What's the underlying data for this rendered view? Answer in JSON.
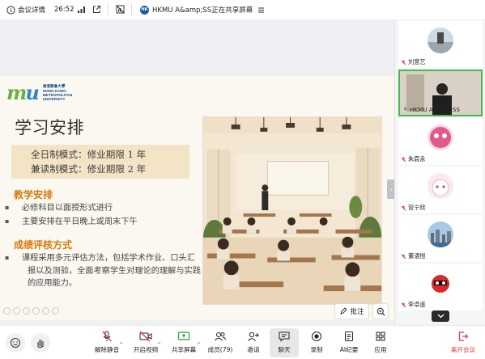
{
  "topbar": {
    "meeting_details": "会议详情",
    "timer": "26:52",
    "sharing_text": "HKMU A&amp;SS正在共享屏幕",
    "share_badge": "HK"
  },
  "slide": {
    "logo_mark_a": "m",
    "logo_mark_b": "u",
    "logo_lines": [
      "香港都會大學",
      "HONG KONG",
      "METROPOLITAN",
      "UNIVERSITY"
    ],
    "title": "学习安排",
    "modes": [
      "全日制模式：修业期限 1 年",
      "兼读制模式：修业期限 2 年"
    ],
    "section1_title": "教学安排",
    "section1_bullets": [
      "必修科目以面授形式进行",
      "主要安排在平日晚上或周末下午"
    ],
    "section2_title": "成绩评核方式",
    "section2_bullets": [
      "课程采用多元评估方法，包括学术作业、口头汇报以及测验，全面考察学生对理论的理解与实践的应用能力。"
    ],
    "annotate_label": "批注"
  },
  "participants": [
    {
      "name": "刘意艺",
      "avatar": "photo-sky",
      "mic": "muted"
    },
    {
      "name": "HKMU A&amp;SS",
      "avatar": "video-presenter",
      "mic": "active",
      "active_speaker": true
    },
    {
      "name": "朱宸永",
      "avatar": "pink-cartoon",
      "mic": "muted"
    },
    {
      "name": "管宁欣",
      "avatar": "white-cat",
      "mic": "muted"
    },
    {
      "name": "董语愷",
      "avatar": "city-skyline",
      "mic": "muted"
    },
    {
      "name": "李卓遥",
      "avatar": "red-cartoon",
      "mic": "muted"
    }
  ],
  "toolbar": {
    "unmute": "解除静音",
    "start_video": "开启视频",
    "share_screen": "共享屏幕",
    "members": "成员(79)",
    "invite": "邀请",
    "chat": "聊天",
    "record": "录制",
    "ai_summary": "AI纪要",
    "apps": "应用",
    "leave": "离开会议"
  },
  "colors": {
    "accent_orange": "#d67b10",
    "mode_box": "#f3e4c6",
    "active_speaker": "#49b74a",
    "leave_red": "#e23a3a",
    "logo_green": "#6ab23e",
    "logo_blue": "#2f86c9"
  }
}
